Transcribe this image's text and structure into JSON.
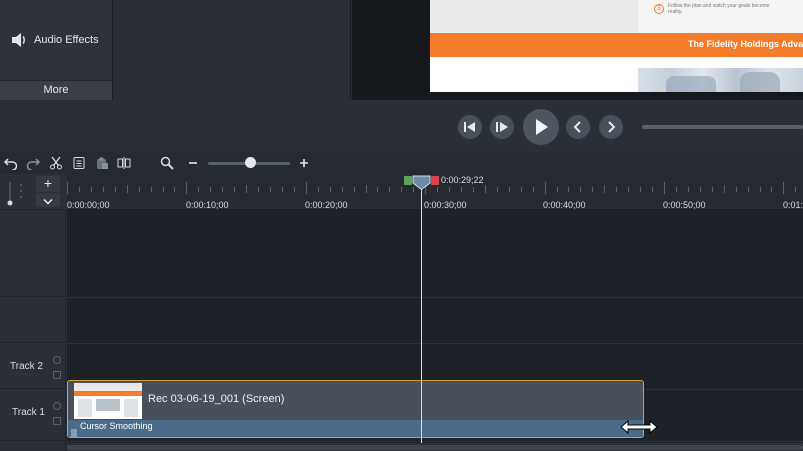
{
  "tools_panel": {
    "audio_effects_label": "Audio Effects",
    "audio_effects_icon": "speaker-icon",
    "more_label": "More"
  },
  "canvas": {
    "preview_small_text": "Follow the plan and watch your goals become reality.",
    "preview_banner_text": "The Fidelity Holdings Adva"
  },
  "playback": {
    "buttons": [
      "step-back-icon",
      "step-forward-icon",
      "play-icon",
      "previous-icon",
      "next-icon"
    ]
  },
  "toolbar": {
    "icons": [
      "undo-icon",
      "redo-icon",
      "cut-icon",
      "copy-icon",
      "paste-icon",
      "split-icon",
      "zoom-search-icon",
      "zoom-out-icon",
      "zoom-in-icon"
    ],
    "zoom_level": 0.5
  },
  "timeline": {
    "playhead_time": "0:00:29;22",
    "ruler_labels": [
      "0:00:00;00",
      "0:00:10;00",
      "0:00:20;00",
      "0:00:30;00",
      "0:00:40;00",
      "0:00:50;00",
      "0:01:"
    ],
    "tracks": [
      {
        "label": "Track 2"
      },
      {
        "label": "Track 1"
      }
    ],
    "add_track_symbol": "+",
    "collapse_symbol": "⌄"
  },
  "clip": {
    "title": "Rec 03-06-19_001 (Screen)",
    "effect_label": "Cursor Smoothing"
  },
  "colors": {
    "clip_border": "#d6a12c",
    "effect_bar": "#4a6b89",
    "in_marker": "#58a55c",
    "out_marker": "#d9434a",
    "banner": "#f47c2a"
  }
}
